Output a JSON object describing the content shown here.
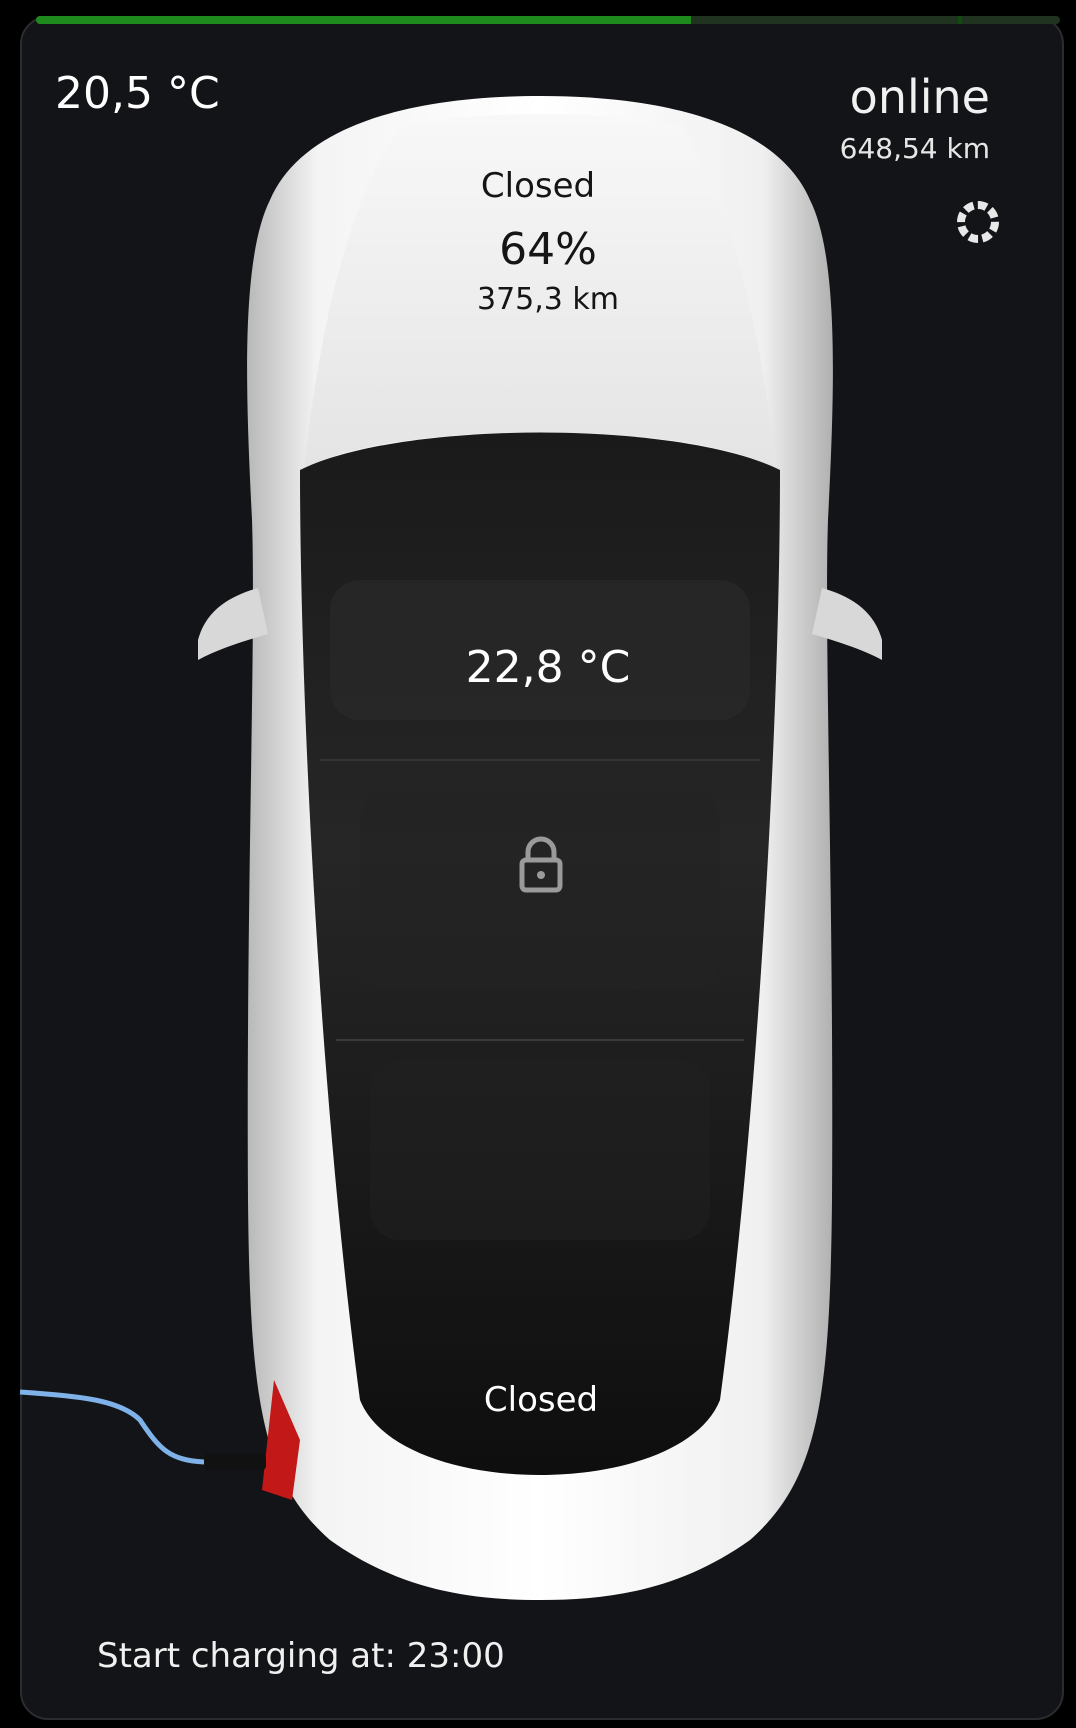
{
  "battery": {
    "level_fraction": 0.64,
    "charge_limit_fraction": 0.9
  },
  "header": {
    "outside_temp": "20,5 °C",
    "connection_status": "online",
    "odometer": "648,54 km",
    "settings_icon": "gear-icon"
  },
  "car": {
    "frunk_status": "Closed",
    "battery_level": "64%",
    "range": "375,3 km",
    "inside_temp": "22,8 °C",
    "lock_icon": "lock-closed-icon",
    "trunk_status": "Closed",
    "charge_cable_icon": "charging-cable-icon"
  },
  "footer": {
    "charge_schedule": "Start charging at: 23:00"
  },
  "colors": {
    "bar_fill": "#1e8a1e",
    "bar_track": "#203220",
    "cable": "#7eb2e8",
    "background": "#131417"
  }
}
